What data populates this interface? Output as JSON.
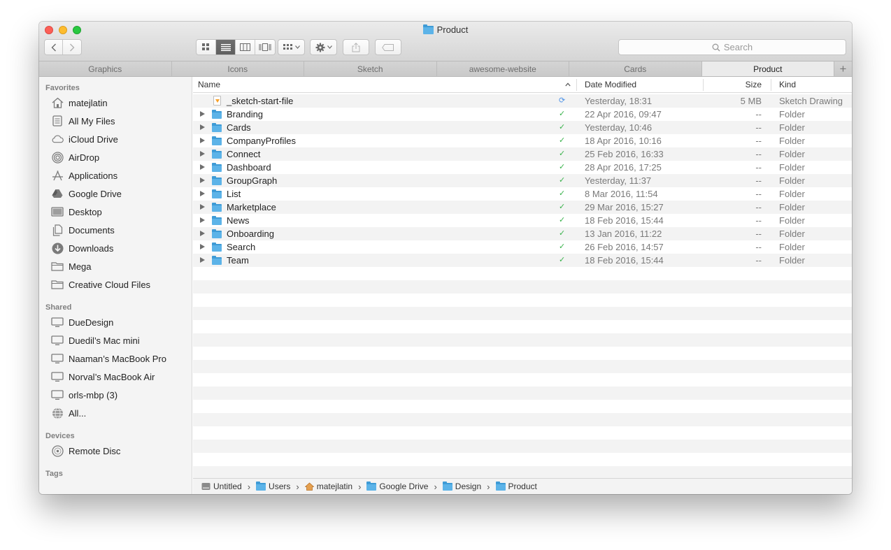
{
  "window": {
    "title": "Product"
  },
  "toolbar": {
    "back_icon": "chevron-left-icon",
    "forward_icon": "chevron-right-icon",
    "view_modes": [
      "icon-view",
      "list-view",
      "column-view",
      "coverflow-view"
    ],
    "active_view": "list-view",
    "arrange_icon": "arrange-icon",
    "action_icon": "gear-icon",
    "share_icon": "share-icon",
    "tag_icon": "tag-icon",
    "search_placeholder": "Search"
  },
  "tabs": [
    {
      "label": "Graphics",
      "active": false
    },
    {
      "label": "Icons",
      "active": false
    },
    {
      "label": "Sketch",
      "active": false
    },
    {
      "label": "awesome-website",
      "active": false
    },
    {
      "label": "Cards",
      "active": false
    },
    {
      "label": "Product",
      "active": true
    }
  ],
  "tab_add_label": "+",
  "sidebar": {
    "favorites_header": "Favorites",
    "favorites": [
      {
        "label": "matejlatin",
        "icon": "home-icon"
      },
      {
        "label": "All My Files",
        "icon": "all-files-icon"
      },
      {
        "label": "iCloud Drive",
        "icon": "cloud-icon"
      },
      {
        "label": "AirDrop",
        "icon": "airdrop-icon"
      },
      {
        "label": "Applications",
        "icon": "applications-icon"
      },
      {
        "label": "Google Drive",
        "icon": "google-drive-icon"
      },
      {
        "label": "Desktop",
        "icon": "desktop-icon"
      },
      {
        "label": "Documents",
        "icon": "documents-icon"
      },
      {
        "label": "Downloads",
        "icon": "downloads-icon"
      },
      {
        "label": "Mega",
        "icon": "folder-icon"
      },
      {
        "label": "Creative Cloud Files",
        "icon": "folder-icon"
      }
    ],
    "shared_header": "Shared",
    "shared": [
      {
        "label": "DueDesign",
        "icon": "computer-icon"
      },
      {
        "label": "Duedil’s Mac mini",
        "icon": "computer-icon"
      },
      {
        "label": "Naaman’s MacBook Pro",
        "icon": "computer-icon"
      },
      {
        "label": "Norval’s MacBook Air",
        "icon": "computer-icon"
      },
      {
        "label": "orls-mbp (3)",
        "icon": "computer-icon"
      },
      {
        "label": "All...",
        "icon": "network-icon"
      }
    ],
    "devices_header": "Devices",
    "devices": [
      {
        "label": "Remote Disc",
        "icon": "disc-icon"
      }
    ],
    "tags_header": "Tags"
  },
  "columns": {
    "name": "Name",
    "date": "Date Modified",
    "size": "Size",
    "kind": "Kind",
    "sort_indicator": "^"
  },
  "files": [
    {
      "name": "_sketch-start-file",
      "status": "⟳",
      "status_color": "#4d92e7",
      "date": "Yesterday, 18:31",
      "size": "5 MB",
      "kind": "Sketch Drawing",
      "type": "sketch"
    },
    {
      "name": "Branding",
      "status": "✓",
      "status_color": "#38b24a",
      "date": "22 Apr 2016, 09:47",
      "size": "--",
      "kind": "Folder",
      "type": "folder"
    },
    {
      "name": "Cards",
      "status": "✓",
      "status_color": "#38b24a",
      "date": "Yesterday, 10:46",
      "size": "--",
      "kind": "Folder",
      "type": "folder"
    },
    {
      "name": "CompanyProfiles",
      "status": "✓",
      "status_color": "#38b24a",
      "date": "18 Apr 2016, 10:16",
      "size": "--",
      "kind": "Folder",
      "type": "folder"
    },
    {
      "name": "Connect",
      "status": "✓",
      "status_color": "#38b24a",
      "date": "25 Feb 2016, 16:33",
      "size": "--",
      "kind": "Folder",
      "type": "folder"
    },
    {
      "name": "Dashboard",
      "status": "✓",
      "status_color": "#38b24a",
      "date": "28 Apr 2016, 17:25",
      "size": "--",
      "kind": "Folder",
      "type": "folder"
    },
    {
      "name": "GroupGraph",
      "status": "✓",
      "status_color": "#38b24a",
      "date": "Yesterday, 11:37",
      "size": "--",
      "kind": "Folder",
      "type": "folder"
    },
    {
      "name": "List",
      "status": "✓",
      "status_color": "#38b24a",
      "date": "8 Mar 2016, 11:54",
      "size": "--",
      "kind": "Folder",
      "type": "folder"
    },
    {
      "name": "Marketplace",
      "status": "✓",
      "status_color": "#38b24a",
      "date": "29 Mar 2016, 15:27",
      "size": "--",
      "kind": "Folder",
      "type": "folder"
    },
    {
      "name": "News",
      "status": "✓",
      "status_color": "#38b24a",
      "date": "18 Feb 2016, 15:44",
      "size": "--",
      "kind": "Folder",
      "type": "folder"
    },
    {
      "name": "Onboarding",
      "status": "✓",
      "status_color": "#38b24a",
      "date": "13 Jan 2016, 11:22",
      "size": "--",
      "kind": "Folder",
      "type": "folder"
    },
    {
      "name": "Search",
      "status": "✓",
      "status_color": "#38b24a",
      "date": "26 Feb 2016, 14:57",
      "size": "--",
      "kind": "Folder",
      "type": "folder"
    },
    {
      "name": "Team",
      "status": "✓",
      "status_color": "#38b24a",
      "date": "18 Feb 2016, 15:44",
      "size": "--",
      "kind": "Folder",
      "type": "folder"
    }
  ],
  "pathbar": [
    {
      "label": "Untitled",
      "icon": "hard-drive-icon"
    },
    {
      "label": "Users",
      "icon": "folder-icon"
    },
    {
      "label": "matejlatin",
      "icon": "home-icon"
    },
    {
      "label": "Google Drive",
      "icon": "google-drive-folder-icon"
    },
    {
      "label": "Design",
      "icon": "folder-icon"
    },
    {
      "label": "Product",
      "icon": "folder-icon"
    }
  ],
  "pathbar_separator": "›",
  "colors": {
    "close": "#fc5f57",
    "minimize": "#fdbc2e",
    "maximize": "#28c840",
    "folder": "#5cb3e8",
    "sync_ok": "#38b24a",
    "sync_pending": "#4d92e7"
  }
}
